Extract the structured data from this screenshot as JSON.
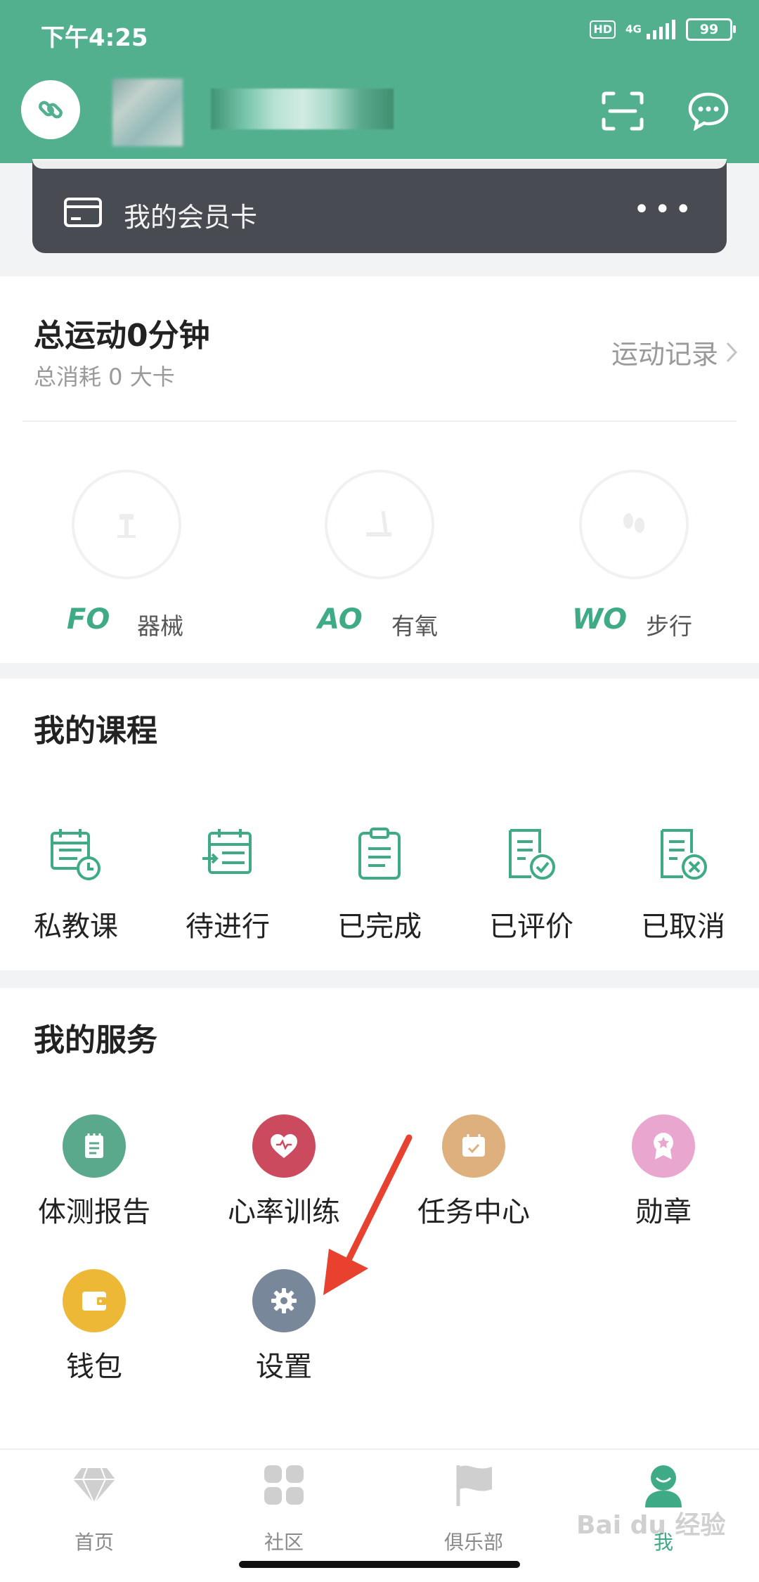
{
  "status_bar": {
    "time": "下午4:25",
    "hd": "HD",
    "network": "4G",
    "battery": "99"
  },
  "member_card": {
    "label": "我的会员卡",
    "more": "•••"
  },
  "exercise": {
    "title": "总运动0分钟",
    "subtitle": "总消耗 0 大卡",
    "record_link": "运动记录",
    "items": [
      {
        "code": "FO",
        "name": "器械",
        "icon": "dumbbell-icon"
      },
      {
        "code": "AO",
        "name": "有氧",
        "icon": "treadmill-icon"
      },
      {
        "code": "WO",
        "name": "步行",
        "icon": "footprints-icon"
      }
    ]
  },
  "courses": {
    "title": "我的课程",
    "items": [
      {
        "label": "私教课",
        "icon": "calendar-clock-icon"
      },
      {
        "label": "待进行",
        "icon": "calendar-arrow-icon"
      },
      {
        "label": "已完成",
        "icon": "clipboard-list-icon"
      },
      {
        "label": "已评价",
        "icon": "document-check-icon"
      },
      {
        "label": "已取消",
        "icon": "document-cancel-icon"
      }
    ]
  },
  "services": {
    "title": "我的服务",
    "items": [
      {
        "label": "体测报告",
        "icon": "report-icon",
        "color": "#5aa98c"
      },
      {
        "label": "心率训练",
        "icon": "heart-rate-icon",
        "color": "#cc4a5d"
      },
      {
        "label": "任务中心",
        "icon": "task-calendar-icon",
        "color": "#ddb07d"
      },
      {
        "label": "勋章",
        "icon": "medal-icon",
        "color": "#e9a6cf"
      },
      {
        "label": "钱包",
        "icon": "wallet-icon",
        "color": "#eeb837"
      },
      {
        "label": "设置",
        "icon": "gear-icon",
        "color": "#78879a"
      }
    ]
  },
  "tabbar": {
    "items": [
      {
        "label": "首页",
        "icon": "diamond-icon"
      },
      {
        "label": "社区",
        "icon": "grid-icon"
      },
      {
        "label": "俱乐部",
        "icon": "flag-icon"
      },
      {
        "label": "我",
        "icon": "person-icon"
      }
    ]
  },
  "watermark": "Bai du 经验",
  "colors": {
    "brand": "#53b08f",
    "accent": "#3fab86",
    "card_dark": "#484b52",
    "arrow": "#e8412f"
  }
}
